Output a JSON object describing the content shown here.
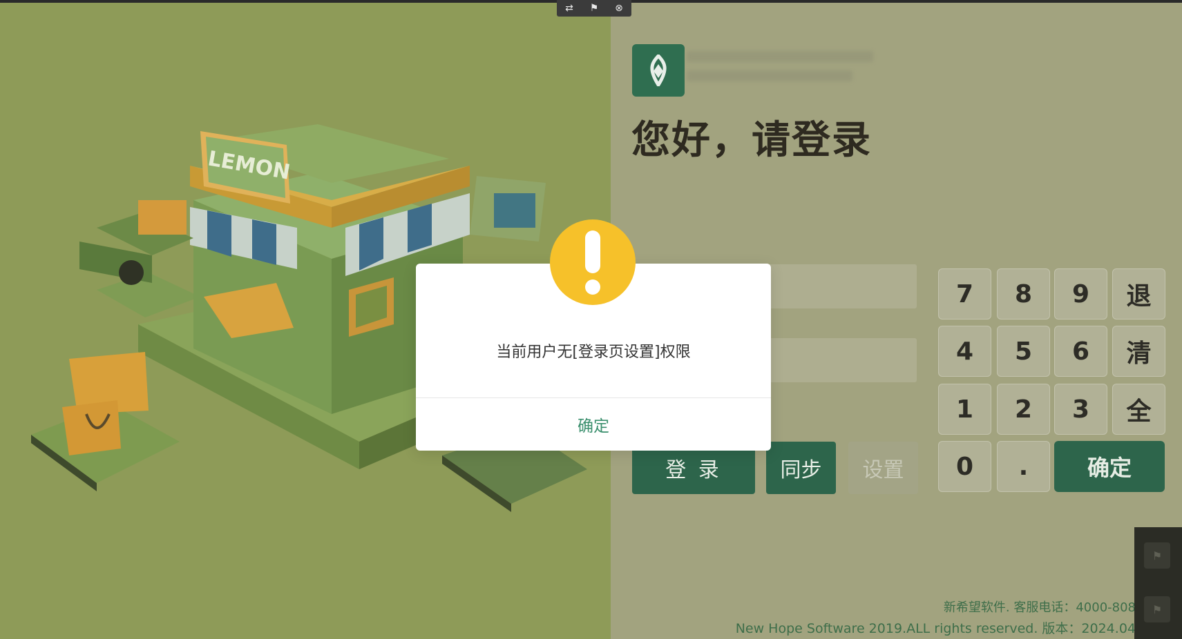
{
  "toolbar": {
    "icons": [
      "swap-icon",
      "flag-icon",
      "close-icon"
    ]
  },
  "login": {
    "greeting": "您好，请登录",
    "buttons": {
      "login": "登 录",
      "sync": "同步",
      "settings": "设置"
    }
  },
  "keypad": {
    "keys": [
      "7",
      "8",
      "9",
      "退",
      "4",
      "5",
      "6",
      "清",
      "1",
      "2",
      "3",
      "全",
      "0",
      "."
    ],
    "confirm": "确定"
  },
  "footer": {
    "phone": "新希望软件. 客服电话：4000-808",
    "copyright": "New Hope Software 2019.ALL rights reserved. 版本：2024.04"
  },
  "illustration": {
    "sign_text": "LEMON"
  },
  "modal": {
    "message": "当前用户无[登录页设置]权限",
    "ok_label": "确定"
  },
  "colors": {
    "brand_green": "#2d654b",
    "warning_yellow": "#f6c12a",
    "link_green": "#3a8f6d"
  }
}
